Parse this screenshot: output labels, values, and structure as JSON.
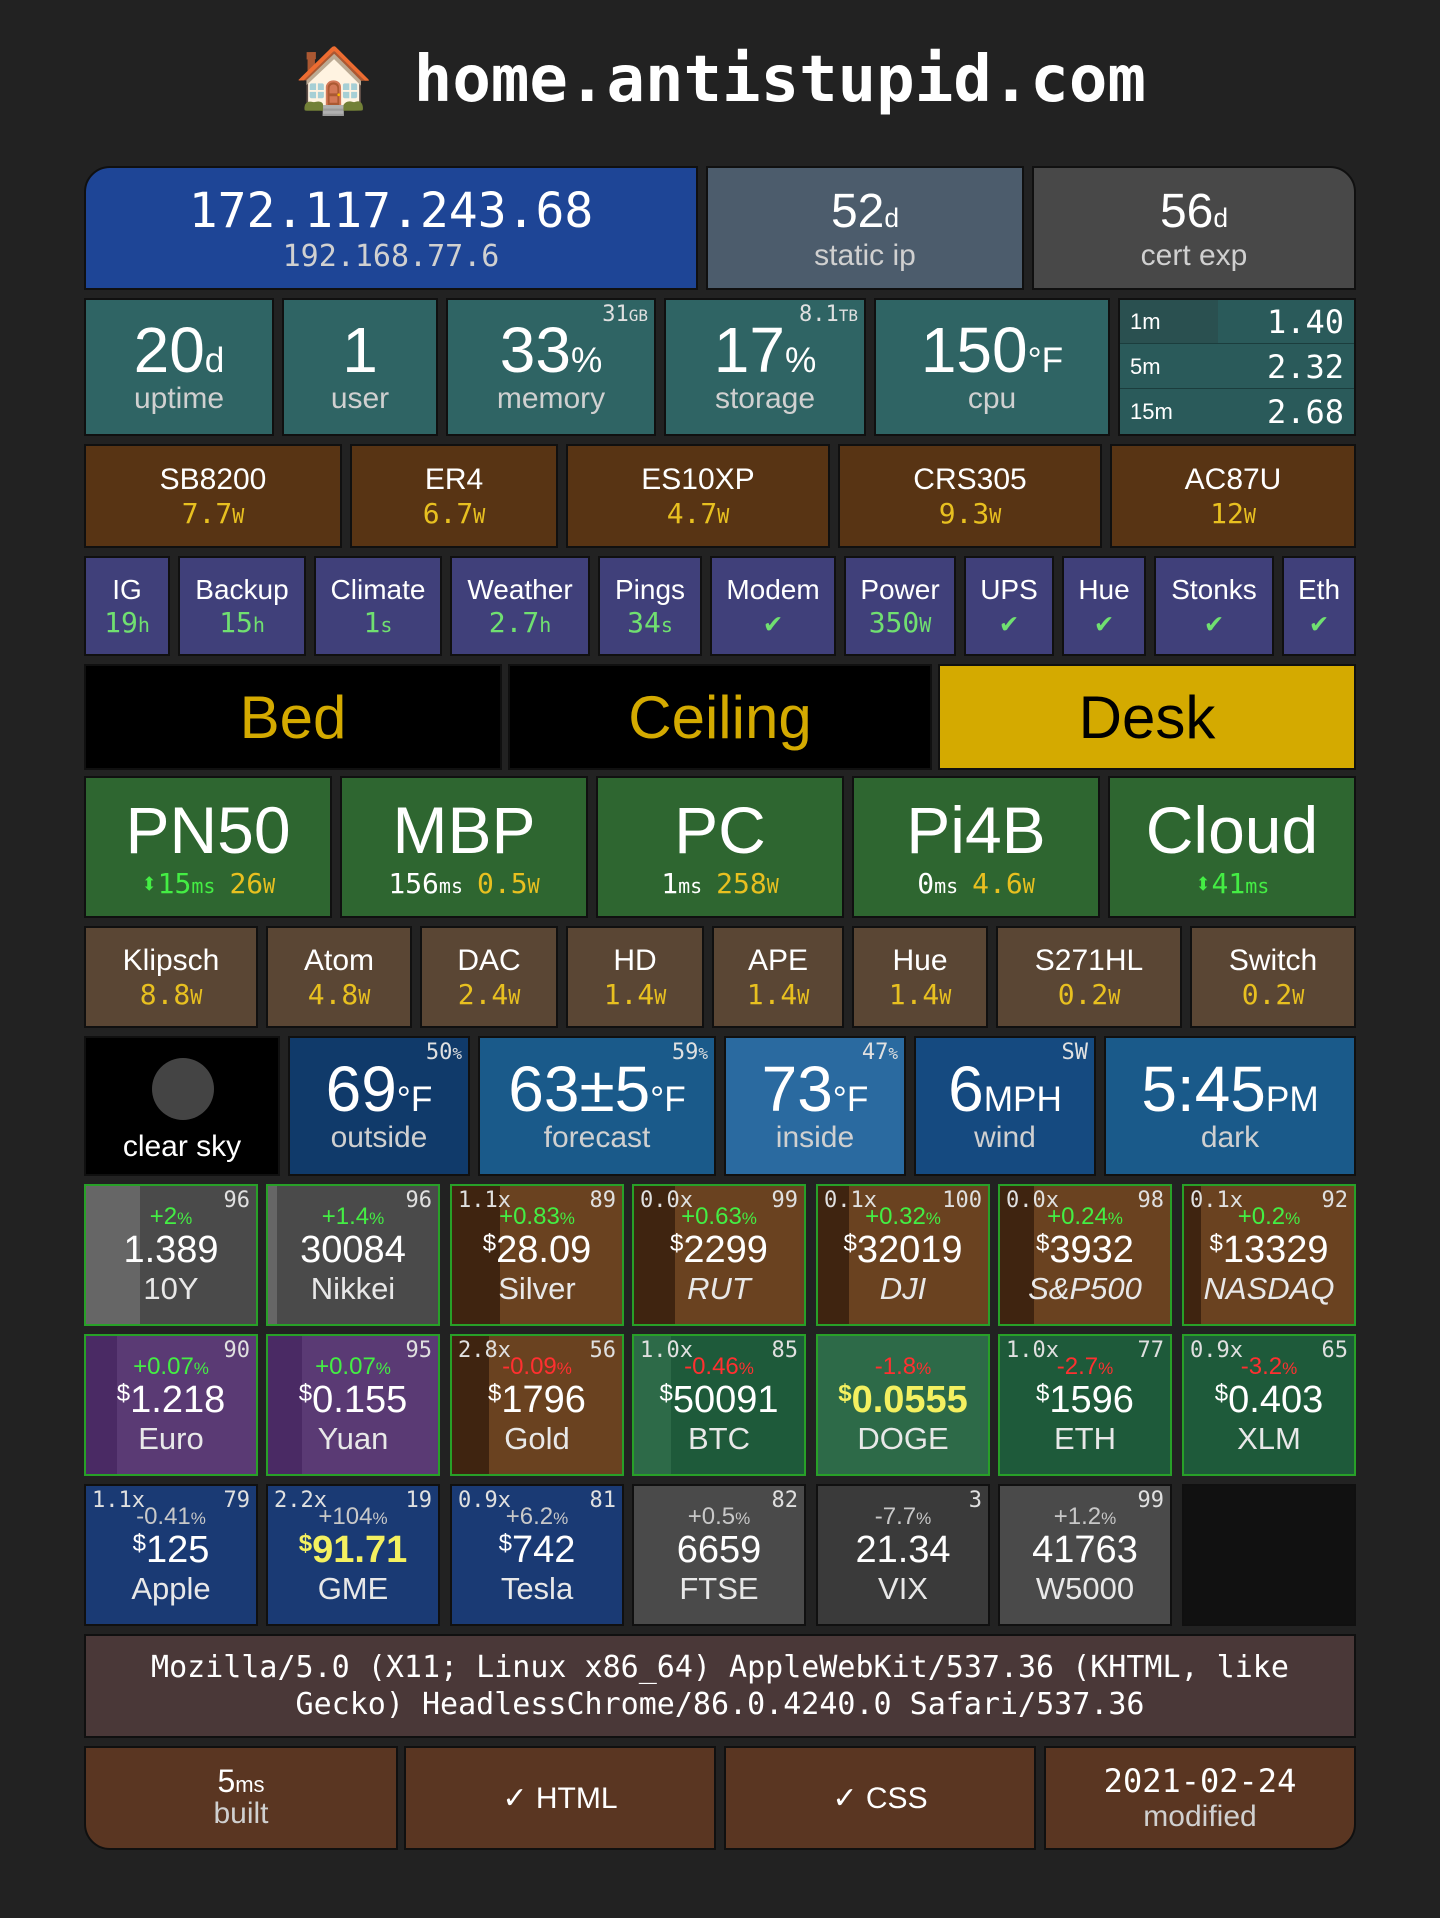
{
  "header": {
    "icon": "🏠",
    "title": "home.antistupid.com"
  },
  "network": {
    "public_ip": "172.117.243.68",
    "local_ip": "192.168.77.6",
    "static_ip_days": "52",
    "static_ip_unit": "d",
    "static_ip_label": "static ip",
    "cert_days": "56",
    "cert_unit": "d",
    "cert_label": "cert exp"
  },
  "system": {
    "uptime": {
      "value": "20",
      "unit": "d",
      "label": "uptime"
    },
    "users": {
      "value": "1",
      "label": "user"
    },
    "memory": {
      "value": "33",
      "unit": "%",
      "label": "memory",
      "total": "31",
      "total_unit": "GB"
    },
    "storage": {
      "value": "17",
      "unit": "%",
      "label": "storage",
      "total": "8.1",
      "total_unit": "TB"
    },
    "cpu": {
      "value": "150",
      "unit": "°F",
      "label": "cpu"
    },
    "load": [
      {
        "label": "1m",
        "value": "1.40"
      },
      {
        "label": "5m",
        "value": "2.32"
      },
      {
        "label": "15m",
        "value": "2.68"
      }
    ]
  },
  "network_devices": [
    {
      "name": "SB8200",
      "watts": "7.7",
      "unit": "W"
    },
    {
      "name": "ER4",
      "watts": "6.7",
      "unit": "W"
    },
    {
      "name": "ES10XP",
      "watts": "4.7",
      "unit": "W"
    },
    {
      "name": "CRS305",
      "watts": "9.3",
      "unit": "W"
    },
    {
      "name": "AC87U",
      "watts": "12",
      "unit": "W"
    }
  ],
  "services": [
    {
      "name": "IG",
      "value": "19",
      "unit": "h"
    },
    {
      "name": "Backup",
      "value": "15",
      "unit": "h"
    },
    {
      "name": "Climate",
      "value": "1",
      "unit": "s"
    },
    {
      "name": "Weather",
      "value": "2.7",
      "unit": "h"
    },
    {
      "name": "Pings",
      "value": "34",
      "unit": "s"
    },
    {
      "name": "Modem",
      "value": "✔",
      "unit": ""
    },
    {
      "name": "Power",
      "value": "350",
      "unit": "W"
    },
    {
      "name": "UPS",
      "value": "✔",
      "unit": ""
    },
    {
      "name": "Hue",
      "value": "✔",
      "unit": ""
    },
    {
      "name": "Stonks",
      "value": "✔",
      "unit": ""
    },
    {
      "name": "Eth",
      "value": "✔",
      "unit": ""
    }
  ],
  "lights": [
    {
      "name": "Bed",
      "on": false
    },
    {
      "name": "Ceiling",
      "on": false
    },
    {
      "name": "Desk",
      "on": true
    }
  ],
  "computers": [
    {
      "name": "PN50",
      "ping": "⬍15",
      "ping_unit": "ms",
      "watts": "26",
      "watt_unit": "W"
    },
    {
      "name": "MBP",
      "ping": "156",
      "ping_unit": "ms",
      "watts": "0.5",
      "watt_unit": "W"
    },
    {
      "name": "PC",
      "ping": "1",
      "ping_unit": "ms",
      "watts": "258",
      "watt_unit": "W"
    },
    {
      "name": "Pi4B",
      "ping": "0",
      "ping_unit": "ms",
      "watts": "4.6",
      "watt_unit": "W"
    },
    {
      "name": "Cloud",
      "ping": "⬍41",
      "ping_unit": "ms",
      "watts": "",
      "watt_unit": ""
    }
  ],
  "appliances": [
    {
      "name": "Klipsch",
      "watts": "8.8",
      "unit": "W"
    },
    {
      "name": "Atom",
      "watts": "4.8",
      "unit": "W"
    },
    {
      "name": "DAC",
      "watts": "2.4",
      "unit": "W"
    },
    {
      "name": "HD",
      "watts": "1.4",
      "unit": "W"
    },
    {
      "name": "APE",
      "watts": "1.4",
      "unit": "W"
    },
    {
      "name": "Hue",
      "watts": "1.4",
      "unit": "W"
    },
    {
      "name": "S271HL",
      "watts": "0.2",
      "unit": "W"
    },
    {
      "name": "Switch",
      "watts": "0.2",
      "unit": "W"
    }
  ],
  "weather": {
    "sky": "clear sky",
    "outside": {
      "value": "69",
      "unit": "°F",
      "label": "outside",
      "humidity": "50",
      "humidity_unit": "%"
    },
    "forecast": {
      "value": "63±5",
      "unit": "°F",
      "label": "forecast",
      "humidity": "59",
      "humidity_unit": "%"
    },
    "inside": {
      "value": "73",
      "unit": "°F",
      "label": "inside",
      "humidity": "47",
      "humidity_unit": "%"
    },
    "wind": {
      "value": "6",
      "unit": "MPH",
      "label": "wind",
      "direction": "SW"
    },
    "time": {
      "value": "5:45",
      "unit": "PM",
      "label": "dark"
    }
  },
  "markets": {
    "row1": [
      {
        "name": "10Y",
        "change": "+2",
        "change_unit": "%",
        "price": "1.389",
        "currency": "",
        "rank": "96",
        "mult": "",
        "dir": "pos",
        "bg": "#4a4a4a",
        "fill": "#666666",
        "fill_frac": 0.32,
        "italic": false
      },
      {
        "name": "Nikkei",
        "change": "+1.4",
        "change_unit": "%",
        "price": "30084",
        "currency": "",
        "rank": "96",
        "mult": "",
        "dir": "pos",
        "bg": "#4a4a4a",
        "fill": "#666666",
        "fill_frac": 0.05,
        "italic": false
      },
      {
        "name": "Silver",
        "change": "+0.83",
        "change_unit": "%",
        "price": "28.09",
        "currency": "$",
        "rank": "89",
        "mult": "1.1x",
        "dir": "pos",
        "bg": "#6a4220",
        "fill": "#3f2410",
        "fill_frac": 0.28,
        "italic": false
      },
      {
        "name": "RUT",
        "change": "+0.63",
        "change_unit": "%",
        "price": "2299",
        "currency": "$",
        "rank": "99",
        "mult": "0.0x",
        "dir": "pos",
        "bg": "#6a4220",
        "fill": "#3f2410",
        "fill_frac": 0.24,
        "italic": true
      },
      {
        "name": "DJI",
        "change": "+0.32",
        "change_unit": "%",
        "price": "32019",
        "currency": "$",
        "rank": "100",
        "mult": "0.1x",
        "dir": "pos",
        "bg": "#6a4220",
        "fill": "#3f2410",
        "fill_frac": 0.18,
        "italic": true
      },
      {
        "name": "S&P500",
        "change": "+0.24",
        "change_unit": "%",
        "price": "3932",
        "currency": "$",
        "rank": "98",
        "mult": "0.0x",
        "dir": "pos",
        "bg": "#6a4220",
        "fill": "#3f2410",
        "fill_frac": 0.2,
        "italic": true
      },
      {
        "name": "NASDAQ",
        "change": "+0.2",
        "change_unit": "%",
        "price": "13329",
        "currency": "$",
        "rank": "92",
        "mult": "0.1x",
        "dir": "pos",
        "bg": "#6a4220",
        "fill": "#3f2410",
        "fill_frac": 0.1,
        "italic": true
      }
    ],
    "row2": [
      {
        "name": "Euro",
        "change": "+0.07",
        "change_unit": "%",
        "price": "1.218",
        "currency": "$",
        "rank": "90",
        "mult": "",
        "dir": "pos",
        "bg": "#5a3a74",
        "fill": "#4a2a64",
        "fill_frac": 0.18,
        "italic": false
      },
      {
        "name": "Yuan",
        "change": "+0.07",
        "change_unit": "%",
        "price": "0.155",
        "currency": "$",
        "rank": "95",
        "mult": "",
        "dir": "pos",
        "bg": "#5a3a74",
        "fill": "#4a2a64",
        "fill_frac": 0.2,
        "italic": false
      },
      {
        "name": "Gold",
        "change": "-0.09",
        "change_unit": "%",
        "price": "1796",
        "currency": "$",
        "rank": "56",
        "mult": "2.8x",
        "dir": "neg",
        "bg": "#6a4220",
        "fill": "#3f2410",
        "fill_frac": 0.22,
        "italic": false
      },
      {
        "name": "BTC",
        "change": "-0.46",
        "change_unit": "%",
        "price": "50091",
        "currency": "$",
        "rank": "85",
        "mult": "1.0x",
        "dir": "neg",
        "bg": "#1e5a3a",
        "fill": "#2d6a48",
        "fill_frac": 0.22,
        "italic": false
      },
      {
        "name": "DOGE",
        "change": "-1.8",
        "change_unit": "%",
        "price": "0.0555",
        "currency": "$",
        "rank": "",
        "mult": "",
        "dir": "neg",
        "bg": "#2d6a48",
        "fill": "#1e5a3a",
        "fill_frac": 0.0,
        "italic": false,
        "highlight": true
      },
      {
        "name": "ETH",
        "change": "-2.7",
        "change_unit": "%",
        "price": "1596",
        "currency": "$",
        "rank": "77",
        "mult": "1.0x",
        "dir": "neg",
        "bg": "#1e5a3a",
        "fill": "#174a30",
        "fill_frac": 0.0,
        "italic": false
      },
      {
        "name": "XLM",
        "change": "-3.2",
        "change_unit": "%",
        "price": "0.403",
        "currency": "$",
        "rank": "65",
        "mult": "0.9x",
        "dir": "neg",
        "bg": "#1e5a3a",
        "fill": "#174a30",
        "fill_frac": 0.0,
        "italic": false
      }
    ],
    "row3": [
      {
        "name": "Apple",
        "change": "-0.41",
        "change_unit": "%",
        "price": "125",
        "currency": "$",
        "rank": "79",
        "mult": "1.1x",
        "dir": "gray",
        "bg": "#1a3a74",
        "italic": false
      },
      {
        "name": "GME",
        "change": "+104",
        "change_unit": "%",
        "price": "91.71",
        "currency": "$",
        "rank": "19",
        "mult": "2.2x",
        "dir": "gray",
        "bg": "#1a3a74",
        "italic": false,
        "highlight": true
      },
      {
        "name": "Tesla",
        "change": "+6.2",
        "change_unit": "%",
        "price": "742",
        "currency": "$",
        "rank": "81",
        "mult": "0.9x",
        "dir": "gray",
        "bg": "#1a3a74",
        "italic": false
      },
      {
        "name": "FTSE",
        "change": "+0.5",
        "change_unit": "%",
        "price": "6659",
        "currency": "",
        "rank": "82",
        "mult": "",
        "dir": "gray",
        "bg": "#4a4a4a",
        "italic": false
      },
      {
        "name": "VIX",
        "change": "-7.7",
        "change_unit": "%",
        "price": "21.34",
        "currency": "",
        "rank": "3",
        "mult": "",
        "dir": "gray",
        "bg": "#3a3a3a",
        "italic": false
      },
      {
        "name": "W5000",
        "change": "+1.2",
        "change_unit": "%",
        "price": "41763",
        "currency": "",
        "rank": "99",
        "mult": "",
        "dir": "gray",
        "bg": "#4a4a4a",
        "italic": false
      }
    ]
  },
  "footer": {
    "user_agent": "Mozilla/5.0 (X11; Linux x86_64) AppleWebKit/537.36 (KHTML, like Gecko) HeadlessChrome/86.0.4240.0 Safari/537.36",
    "built_value": "5",
    "built_unit": "ms",
    "built_label": "built",
    "html_check": "✓ HTML",
    "css_check": "✓ CSS",
    "modified_date": "2021-02-24",
    "modified_label": "modified"
  }
}
